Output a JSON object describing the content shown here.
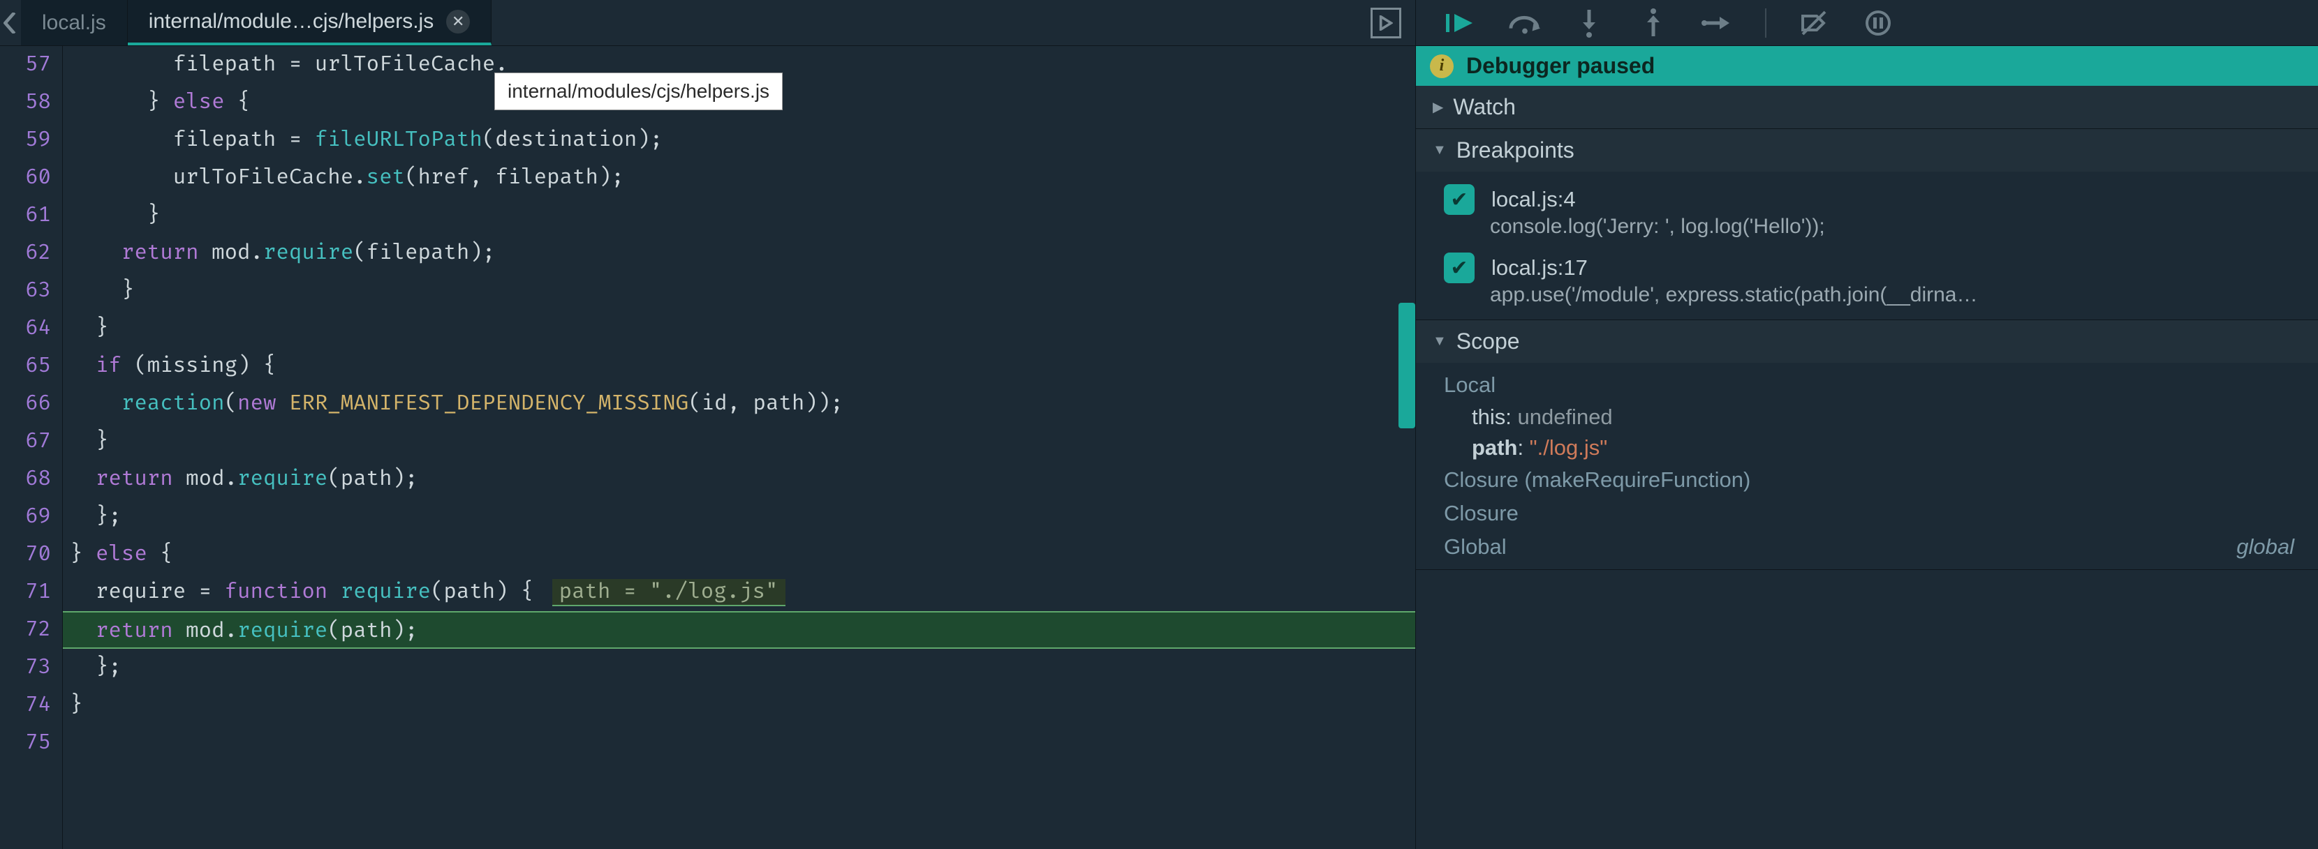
{
  "tabs": [
    {
      "label": "local.js",
      "active": false
    },
    {
      "label": "internal/module…cjs/helpers.js",
      "active": true
    }
  ],
  "tooltip": "internal/modules/cjs/helpers.js",
  "gutter_start": 57,
  "gutter_end": 75,
  "code_lines": [
    {
      "n": 57,
      "html": "        filepath = urlToFileCache."
    },
    {
      "n": 58,
      "html": "      } <span class='tk-pu'>else</span> {"
    },
    {
      "n": 59,
      "html": "        filepath = <span class='tk-cy'>fileURLToPath</span>(destination);"
    },
    {
      "n": 60,
      "html": "        urlToFileCache.<span class='tk-cy'>set</span>(href, filepath);"
    },
    {
      "n": 61,
      "html": "      }"
    },
    {
      "n": 62,
      "html": "    <span class='tk-pu'>return</span> mod.<span class='tk-cy'>require</span>(filepath);"
    },
    {
      "n": 63,
      "html": "    }"
    },
    {
      "n": 64,
      "html": "  }"
    },
    {
      "n": 65,
      "html": "  <span class='tk-pu'>if</span> (missing) {"
    },
    {
      "n": 66,
      "html": "    <span class='tk-cy'>reaction</span>(<span class='tk-pu'>new</span> <span class='tk-ye'>ERR_MANIFEST_DEPENDENCY_MISSING</span>(id, path));"
    },
    {
      "n": 67,
      "html": "  }"
    },
    {
      "n": 68,
      "html": "  <span class='tk-pu'>return</span> mod.<span class='tk-cy'>require</span>(path);"
    },
    {
      "n": 69,
      "html": "  };"
    },
    {
      "n": 70,
      "html": "} <span class='tk-pu'>else</span> {"
    },
    {
      "n": 71,
      "html": "  require = <span class='tk-pu'>function</span> <span class='tk-cy'>require</span>(path) {",
      "hint": "path = \"./log.js\""
    },
    {
      "n": 72,
      "html": "  <span class='tk-pu'>return</span> mod.<span class='tk-cy'>require</span>(path);",
      "exec": true
    },
    {
      "n": 73,
      "html": "  };"
    },
    {
      "n": 74,
      "html": "}"
    },
    {
      "n": 75,
      "html": ""
    }
  ],
  "toolbar_icons": [
    "resume",
    "step-over",
    "step-into",
    "step-out",
    "step",
    "deactivate-breakpoints",
    "pause-on-exceptions"
  ],
  "status_text": "Debugger paused",
  "sections": {
    "watch": {
      "label": "Watch",
      "open": false
    },
    "breakpoints": {
      "label": "Breakpoints",
      "open": true,
      "items": [
        {
          "location": "local.js:4",
          "code": "console.log('Jerry: ', log.log('Hello'));",
          "checked": true
        },
        {
          "location": "local.js:17",
          "code": "app.use('/module', express.static(path.join(__dirna…",
          "checked": true
        }
      ]
    },
    "scope": {
      "label": "Scope",
      "open": true,
      "groups": [
        {
          "name": "Local",
          "vars": [
            {
              "name": "this",
              "value": "undefined",
              "kind": "undef"
            },
            {
              "name": "path",
              "value": "\"./log.js\"",
              "kind": "str",
              "bold": true
            }
          ]
        },
        {
          "name": "Closure (makeRequireFunction)"
        },
        {
          "name": "Closure"
        },
        {
          "name": "Global",
          "rhs": "global"
        }
      ]
    }
  }
}
